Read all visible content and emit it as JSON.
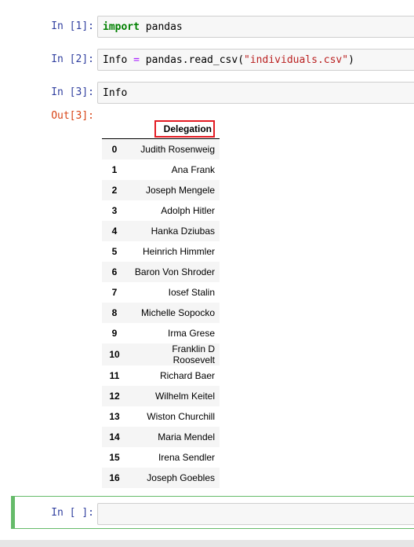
{
  "cells": [
    {
      "prompt": "In [1]:",
      "keyword": "import",
      "rest": " pandas"
    },
    {
      "prompt": "In [2]:",
      "var": "Info",
      "op": "=",
      "call": " pandas.read_csv(",
      "string": "\"individuals.csv\"",
      "close": ")"
    },
    {
      "prompt": "In [3]:",
      "code": "Info"
    }
  ],
  "output": {
    "prompt": "Out[3]:",
    "column_header": "Delegation",
    "rows": [
      {
        "index": "0",
        "value": "Judith Rosenweig"
      },
      {
        "index": "1",
        "value": "Ana Frank"
      },
      {
        "index": "2",
        "value": "Joseph Mengele"
      },
      {
        "index": "3",
        "value": "Adolph Hitler"
      },
      {
        "index": "4",
        "value": "Hanka Dziubas"
      },
      {
        "index": "5",
        "value": "Heinrich Himmler"
      },
      {
        "index": "6",
        "value": "Baron Von Shroder"
      },
      {
        "index": "7",
        "value": "Iosef Stalin"
      },
      {
        "index": "8",
        "value": "Michelle Sopocko"
      },
      {
        "index": "9",
        "value": "Irma Grese"
      },
      {
        "index": "10",
        "value": "Franklin D Roosevelt"
      },
      {
        "index": "11",
        "value": "Richard Baer"
      },
      {
        "index": "12",
        "value": "Wilhelm Keitel"
      },
      {
        "index": "13",
        "value": "Wiston Churchill"
      },
      {
        "index": "14",
        "value": "Maria Mendel"
      },
      {
        "index": "15",
        "value": "Irena Sendler"
      },
      {
        "index": "16",
        "value": "Joseph Goebles"
      }
    ]
  },
  "empty_cell": {
    "prompt": "In [ ]:",
    "value": ""
  },
  "colors": {
    "prompt_in": "#303f9f",
    "prompt_out": "#d84315",
    "keyword": "#008000",
    "operator": "#aa22ff",
    "string": "#ba2121",
    "highlight_box": "#e31b23",
    "selected_cell_border": "#66bb6a"
  }
}
